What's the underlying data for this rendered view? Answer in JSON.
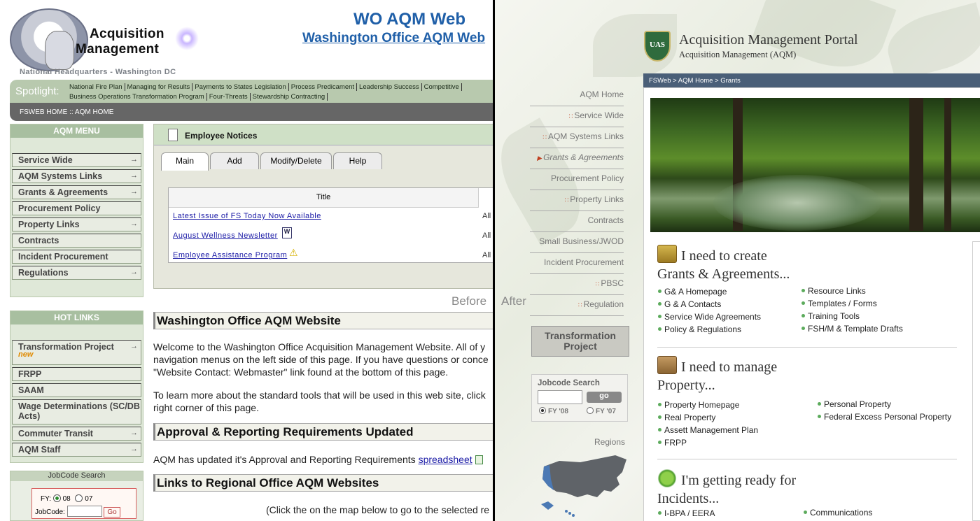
{
  "before": {
    "logo_line1": "Acquisition",
    "logo_line2": "Management",
    "hq": "National Headquarters - Washington DC",
    "title": "WO AQM Web",
    "subtitle": "Washington Office AQM Web",
    "spotlight_label": "Spotlight:",
    "spotlight_links": [
      "National Fire Plan",
      "Managing for Results",
      "Payments to States Legislation",
      "Process Predicament",
      "Leadership Success",
      "Competitive"
    ],
    "spotlight_links2": [
      "Business Operations Transformation Program",
      "Four-Threats",
      "Stewardship Contracting"
    ],
    "fsbar": "FSWEB HOME :: AQM HOME",
    "aqm_menu_title": "AQM MENU",
    "aqm_menu": [
      {
        "label": "Service Wide",
        "arrow": true
      },
      {
        "label": "AQM Systems Links",
        "arrow": true
      },
      {
        "label": "Grants & Agreements",
        "arrow": true
      },
      {
        "label": "Procurement Policy",
        "arrow": false
      },
      {
        "label": "Property Links",
        "arrow": true
      },
      {
        "label": "Contracts",
        "arrow": false
      },
      {
        "label": "Incident Procurement",
        "arrow": false
      },
      {
        "label": "Regulations",
        "arrow": true
      }
    ],
    "hot_links_title": "HOT LINKS",
    "hot_links": [
      {
        "label": "Transformation Project",
        "badge": "new",
        "arrow": true
      },
      {
        "label": "FRPP",
        "arrow": false
      },
      {
        "label": "SAAM",
        "arrow": false
      },
      {
        "label": "Wage Determinations (SC/DB Acts)",
        "arrow": false
      },
      {
        "label": "Commuter Transit",
        "arrow": true
      },
      {
        "label": "AQM Staff",
        "arrow": true
      }
    ],
    "jobcode": {
      "title": "JobCode Search",
      "fy_label": "FY:",
      "fy_opt1": "08",
      "fy_opt2": "07",
      "jobcode_label": "JobCode:",
      "go": "Go"
    },
    "notices": {
      "title": "Employee Notices",
      "tabs": [
        "Main",
        "Add",
        "Modify/Delete",
        "Help"
      ],
      "column": "Title",
      "rows": [
        {
          "title": "Latest Issue of FS Today Now Available",
          "aud": "All"
        },
        {
          "title": "August Wellness Newsletter",
          "aud": "All"
        },
        {
          "title": "Employee Assistance Program",
          "aud": "All"
        }
      ]
    },
    "label": "Before",
    "section1": "Washington Office AQM Website",
    "para1": "Welcome to the Washington Office Acquisition Management Website. All of y navigation menus on the left side of this page. If you have questions or conce \"Website Contact: Webmaster\" link found at the bottom of this page.",
    "para2": "To learn more about the standard tools that will be used in this web site, click right corner of this page.",
    "section2": "Approval & Reporting Requirements Updated",
    "para3_pre": "AQM has updated it's Approval and Reporting Requirements ",
    "para3_link": "spreadsheet",
    "section3": "Links to Regional Office AQM Websites",
    "para4": "(Click the on the map below to go to the selected re"
  },
  "after": {
    "label": "After",
    "portal_title": "Acquisition Management Portal",
    "portal_sub": "Acquisition Management (AQM)",
    "shield_text": "UAS",
    "breadcrumb": "FSWeb > AQM Home > Grants",
    "nav": [
      {
        "label": "AQM Home",
        "bullet": false
      },
      {
        "label": "Service Wide",
        "bullet": true
      },
      {
        "label": "AQM Systems Links",
        "bullet": true
      },
      {
        "label": "Grants & Agreements",
        "bullet": true,
        "current": true
      },
      {
        "label": "Procurement Policy",
        "bullet": false
      },
      {
        "label": "Property Links",
        "bullet": true
      },
      {
        "label": "Contracts",
        "bullet": false
      },
      {
        "label": "Small Business/JWOD",
        "bullet": false
      },
      {
        "label": "Incident Procurement",
        "bullet": false
      },
      {
        "label": "PBSC",
        "bullet": true
      },
      {
        "label": "Regulation",
        "bullet": true
      }
    ],
    "transformation_btn": "Transformation Project",
    "jobcode": {
      "title": "Jobcode Search",
      "go": "go",
      "fy1": "FY '08",
      "fy2": "FY '07"
    },
    "regions": "Regions",
    "need1_title": "I need to create",
    "need1_title2": "Grants & Agreements...",
    "need1_left": [
      "G& A Homepage",
      "G & A Contacts",
      "Service Wide Agreements",
      "Policy & Regulations"
    ],
    "need1_right": [
      "Resource Links",
      "Templates / Forms",
      "Training Tools",
      "FSH/M & Template Drafts"
    ],
    "need2_title": "I need to manage",
    "need2_title2": "Property...",
    "need2_left": [
      "Property Homepage",
      "Real Property",
      "Assett Management Plan",
      "FRPP"
    ],
    "need2_right": [
      "Personal Property",
      "Federal Excess Personal Property"
    ],
    "need3_title": "I'm getting ready for",
    "need3_title2": "Incidents...",
    "need3_left": [
      "I-BPA / EERA"
    ],
    "need3_right": [
      "Communications"
    ]
  }
}
